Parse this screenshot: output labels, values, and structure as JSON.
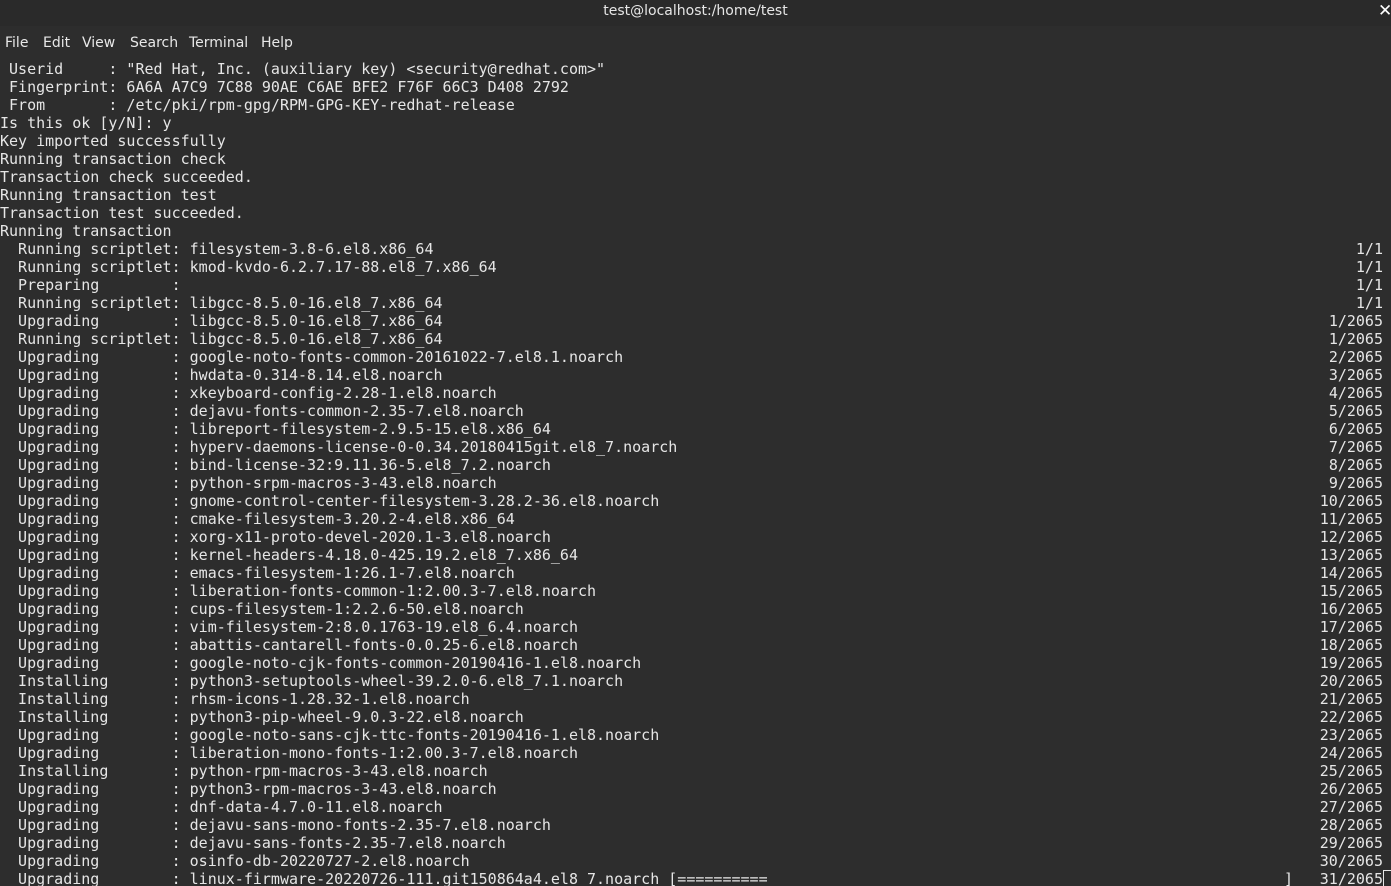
{
  "window": {
    "title": "test@localhost:/home/test",
    "close_glyph": "✕"
  },
  "menu": {
    "items": [
      "File",
      "Edit",
      "View",
      "Search",
      "Terminal",
      "Help"
    ]
  },
  "terminal": {
    "lines": [
      {
        "text": " Userid     : \"Red Hat, Inc. (auxiliary key) <security@redhat.com>\"",
        "count": ""
      },
      {
        "text": " Fingerprint: 6A6A A7C9 7C88 90AE C6AE BFE2 F76F 66C3 D408 2792",
        "count": ""
      },
      {
        "text": " From       : /etc/pki/rpm-gpg/RPM-GPG-KEY-redhat-release",
        "count": ""
      },
      {
        "text": "Is this ok [y/N]: y",
        "count": ""
      },
      {
        "text": "Key imported successfully",
        "count": ""
      },
      {
        "text": "Running transaction check",
        "count": ""
      },
      {
        "text": "Transaction check succeeded.",
        "count": ""
      },
      {
        "text": "Running transaction test",
        "count": ""
      },
      {
        "text": "Transaction test succeeded.",
        "count": ""
      },
      {
        "text": "Running transaction",
        "count": ""
      },
      {
        "text": "  Running scriptlet: filesystem-3.8-6.el8.x86_64",
        "count": "1/1"
      },
      {
        "text": "  Running scriptlet: kmod-kvdo-6.2.7.17-88.el8_7.x86_64",
        "count": "1/1"
      },
      {
        "text": "  Preparing        :",
        "count": "1/1"
      },
      {
        "text": "  Running scriptlet: libgcc-8.5.0-16.el8_7.x86_64",
        "count": "1/1"
      },
      {
        "text": "  Upgrading        : libgcc-8.5.0-16.el8_7.x86_64",
        "count": "1/2065"
      },
      {
        "text": "  Running scriptlet: libgcc-8.5.0-16.el8_7.x86_64",
        "count": "1/2065"
      },
      {
        "text": "  Upgrading        : google-noto-fonts-common-20161022-7.el8.1.noarch",
        "count": "2/2065"
      },
      {
        "text": "  Upgrading        : hwdata-0.314-8.14.el8.noarch",
        "count": "3/2065"
      },
      {
        "text": "  Upgrading        : xkeyboard-config-2.28-1.el8.noarch",
        "count": "4/2065"
      },
      {
        "text": "  Upgrading        : dejavu-fonts-common-2.35-7.el8.noarch",
        "count": "5/2065"
      },
      {
        "text": "  Upgrading        : libreport-filesystem-2.9.5-15.el8.x86_64",
        "count": "6/2065"
      },
      {
        "text": "  Upgrading        : hyperv-daemons-license-0-0.34.20180415git.el8_7.noarch",
        "count": "7/2065"
      },
      {
        "text": "  Upgrading        : bind-license-32:9.11.36-5.el8_7.2.noarch",
        "count": "8/2065"
      },
      {
        "text": "  Upgrading        : python-srpm-macros-3-43.el8.noarch",
        "count": "9/2065"
      },
      {
        "text": "  Upgrading        : gnome-control-center-filesystem-3.28.2-36.el8.noarch",
        "count": "10/2065"
      },
      {
        "text": "  Upgrading        : cmake-filesystem-3.20.2-4.el8.x86_64",
        "count": "11/2065"
      },
      {
        "text": "  Upgrading        : xorg-x11-proto-devel-2020.1-3.el8.noarch",
        "count": "12/2065"
      },
      {
        "text": "  Upgrading        : kernel-headers-4.18.0-425.19.2.el8_7.x86_64",
        "count": "13/2065"
      },
      {
        "text": "  Upgrading        : emacs-filesystem-1:26.1-7.el8.noarch",
        "count": "14/2065"
      },
      {
        "text": "  Upgrading        : liberation-fonts-common-1:2.00.3-7.el8.noarch",
        "count": "15/2065"
      },
      {
        "text": "  Upgrading        : cups-filesystem-1:2.2.6-50.el8.noarch",
        "count": "16/2065"
      },
      {
        "text": "  Upgrading        : vim-filesystem-2:8.0.1763-19.el8_6.4.noarch",
        "count": "17/2065"
      },
      {
        "text": "  Upgrading        : abattis-cantarell-fonts-0.0.25-6.el8.noarch",
        "count": "18/2065"
      },
      {
        "text": "  Upgrading        : google-noto-cjk-fonts-common-20190416-1.el8.noarch",
        "count": "19/2065"
      },
      {
        "text": "  Installing       : python3-setuptools-wheel-39.2.0-6.el8_7.1.noarch",
        "count": "20/2065"
      },
      {
        "text": "  Installing       : rhsm-icons-1.28.32-1.el8.noarch",
        "count": "21/2065"
      },
      {
        "text": "  Installing       : python3-pip-wheel-9.0.3-22.el8.noarch",
        "count": "22/2065"
      },
      {
        "text": "  Upgrading        : google-noto-sans-cjk-ttc-fonts-20190416-1.el8.noarch",
        "count": "23/2065"
      },
      {
        "text": "  Upgrading        : liberation-mono-fonts-1:2.00.3-7.el8.noarch",
        "count": "24/2065"
      },
      {
        "text": "  Installing       : python-rpm-macros-3-43.el8.noarch",
        "count": "25/2065"
      },
      {
        "text": "  Upgrading        : python3-rpm-macros-3-43.el8.noarch",
        "count": "26/2065"
      },
      {
        "text": "  Upgrading        : dnf-data-4.7.0-11.el8.noarch",
        "count": "27/2065"
      },
      {
        "text": "  Upgrading        : dejavu-sans-mono-fonts-2.35-7.el8.noarch",
        "count": "28/2065"
      },
      {
        "text": "  Upgrading        : dejavu-sans-fonts-2.35-7.el8.noarch",
        "count": "29/2065"
      },
      {
        "text": "  Upgrading        : osinfo-db-20220727-2.el8.noarch",
        "count": "30/2065"
      }
    ],
    "progress_line": {
      "text": "  Upgrading        : linux-firmware-20220726-111.git150864a4.el8_7.noarch [==========",
      "bar_end": "]",
      "count": "31/2065",
      "progress_fraction": 0.25
    }
  }
}
